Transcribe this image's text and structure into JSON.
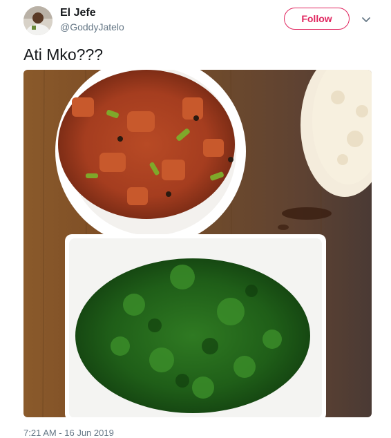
{
  "author": {
    "display_name": "El Jefe",
    "handle": "@GoddyJatelo"
  },
  "actions": {
    "follow_label": "Follow",
    "accent_color": "#e0245e"
  },
  "icons": {
    "more": "chevron-down-icon"
  },
  "tweet": {
    "text": "Ati Mko???",
    "timestamp": "7:21 AM - 16 Jun 2019",
    "media_description": "Photo of chicken stew, ugali and sukuma wiki on a wooden table"
  }
}
